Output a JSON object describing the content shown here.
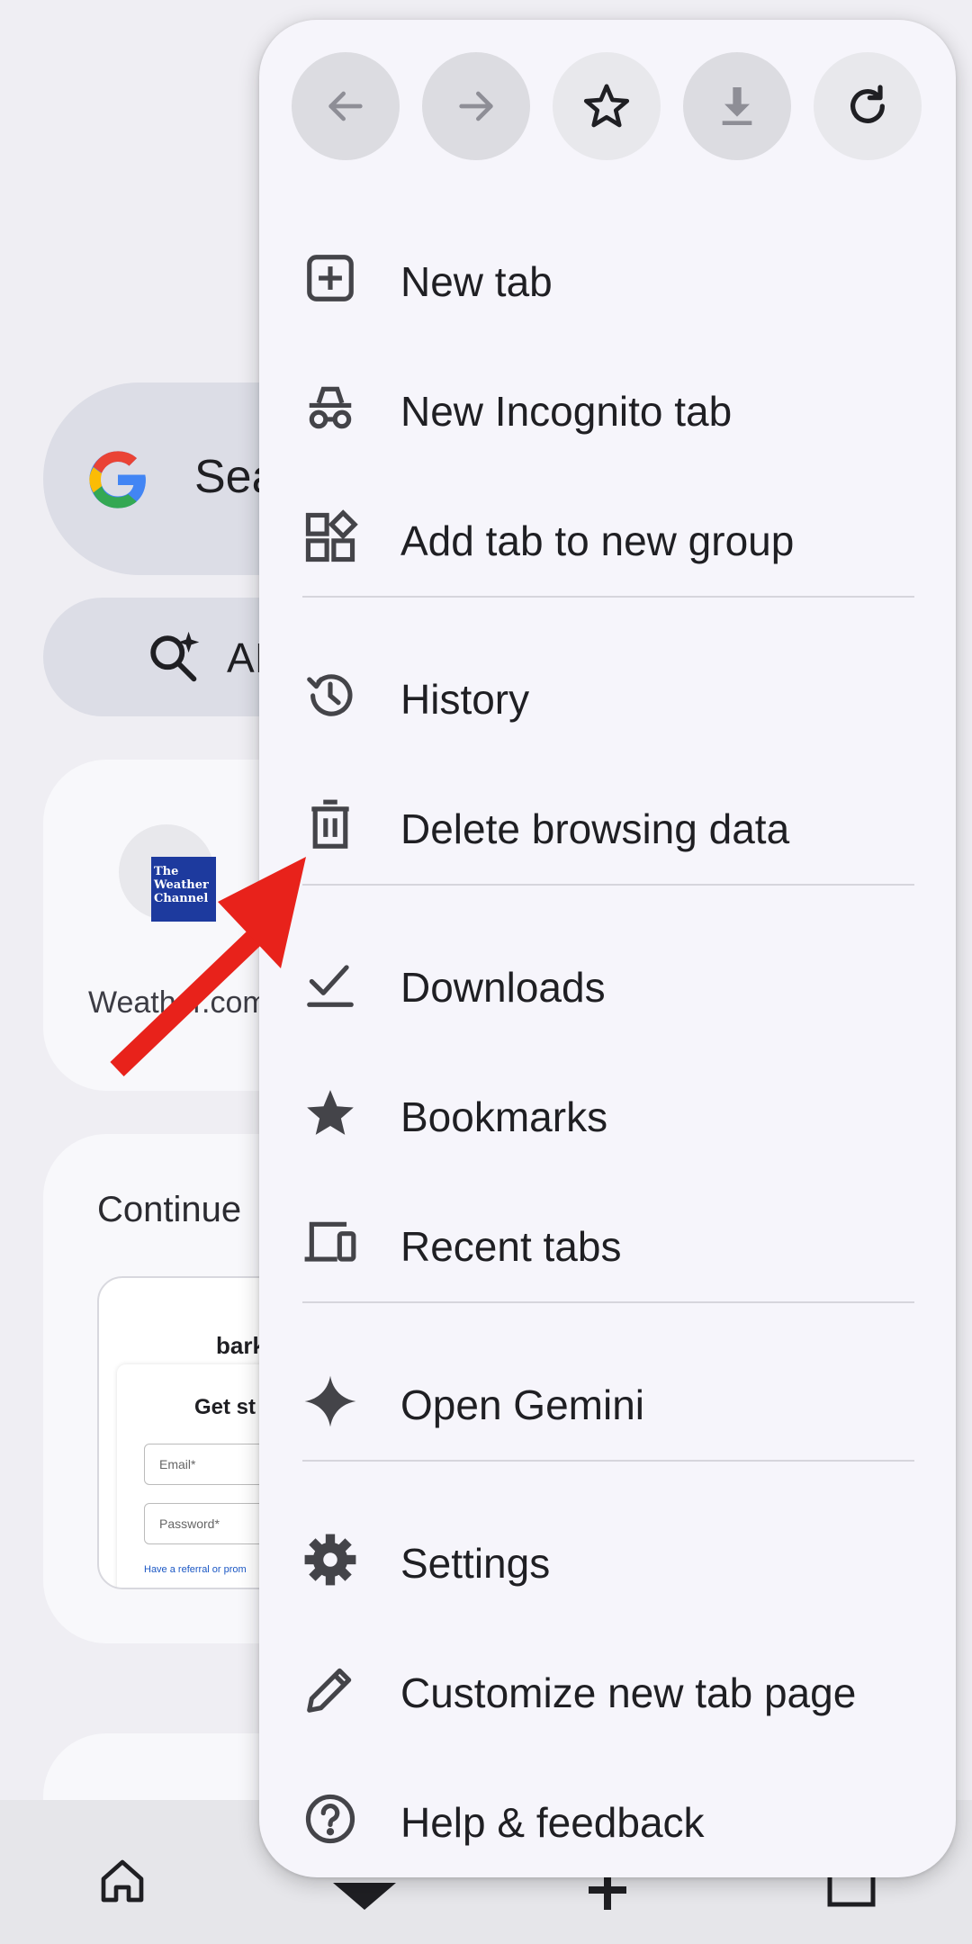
{
  "background": {
    "search_text": "Sea",
    "ai_text": "AI",
    "shortcut_label": "Weather.com",
    "weather_logo_text": "The Weather Channel",
    "continue_title": "Continue",
    "thumb": {
      "brand": "bark",
      "heading": "Get st",
      "email_placeholder": "Email*",
      "password_placeholder": "Password*",
      "link": "Have a referral or prom"
    }
  },
  "menu": {
    "top_buttons": [
      {
        "name": "back",
        "icon": "back-arrow-icon"
      },
      {
        "name": "forward",
        "icon": "forward-arrow-icon"
      },
      {
        "name": "bookmark",
        "icon": "star-outline-icon"
      },
      {
        "name": "download",
        "icon": "download-icon"
      },
      {
        "name": "refresh",
        "icon": "refresh-icon"
      }
    ],
    "items": [
      {
        "label": "New tab",
        "icon": "new-tab-icon"
      },
      {
        "label": "New Incognito tab",
        "icon": "incognito-icon"
      },
      {
        "label": "Add tab to new group",
        "icon": "tab-group-icon"
      },
      {
        "label": "History",
        "icon": "history-icon"
      },
      {
        "label": "Delete browsing data",
        "icon": "trash-icon"
      },
      {
        "label": "Downloads",
        "icon": "downloads-check-icon"
      },
      {
        "label": "Bookmarks",
        "icon": "star-icon"
      },
      {
        "label": "Recent tabs",
        "icon": "devices-icon"
      },
      {
        "label": "Open Gemini",
        "icon": "gemini-sparkle-icon"
      },
      {
        "label": "Settings",
        "icon": "gear-icon"
      },
      {
        "label": "Customize new tab page",
        "icon": "pencil-icon"
      },
      {
        "label": "Help & feedback",
        "icon": "help-icon"
      }
    ]
  },
  "colors": {
    "menu_bg": "#f6f5fb",
    "page_bg": "#efeef3",
    "annotation_arrow": "#e8221b"
  }
}
